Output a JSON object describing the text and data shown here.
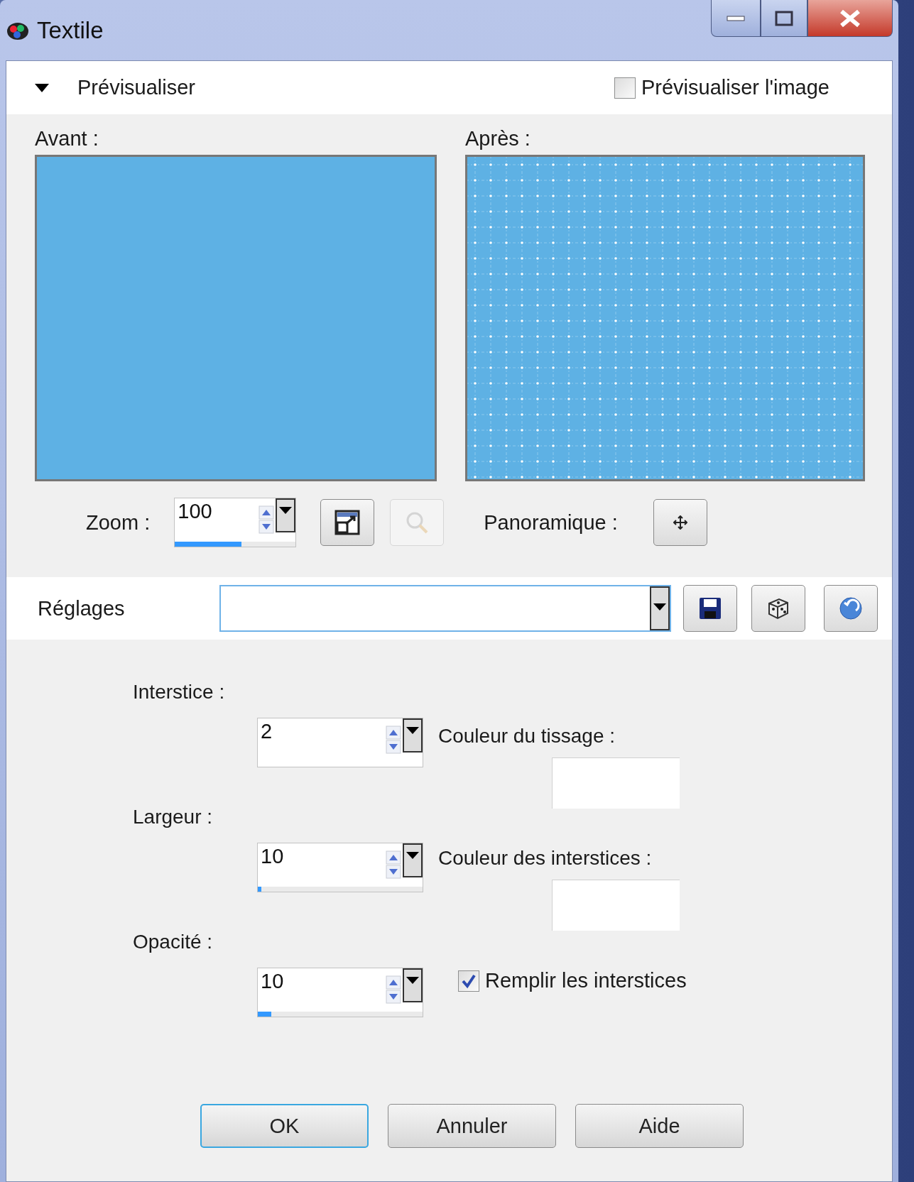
{
  "window": {
    "title": "Textile"
  },
  "preview_section": {
    "title": "Prévisualiser",
    "expanded": true,
    "preview_image": {
      "label": "Prévisualiser l'image",
      "checked": false
    }
  },
  "before": {
    "label": "Avant :"
  },
  "after": {
    "label": "Après :"
  },
  "zoom": {
    "label": "Zoom :",
    "value": "100",
    "level": 0.55,
    "fit_disabled": false,
    "magnify_disabled": true
  },
  "pan": {
    "label": "Panoramique :"
  },
  "presets": {
    "label": "Réglages"
  },
  "params": [
    {
      "label": "Interstice :",
      "value": "2"
    },
    {
      "label": "Largeur :",
      "value": "10",
      "level": 0.02
    },
    {
      "label": "Opacité :",
      "value": "10",
      "level": 0.08
    }
  ],
  "colors": [
    {
      "label": "Couleur du tissage :",
      "color": "#ffffff"
    },
    {
      "label": "Couleur des interstices :",
      "color": "#ffffff"
    }
  ],
  "fill_gaps": {
    "label": "Remplir les interstices",
    "checked": true
  },
  "buttons": [
    {
      "label": "OK",
      "default": true
    },
    {
      "label": "Annuler",
      "default": false
    },
    {
      "label": "Aide",
      "default": false
    }
  ]
}
